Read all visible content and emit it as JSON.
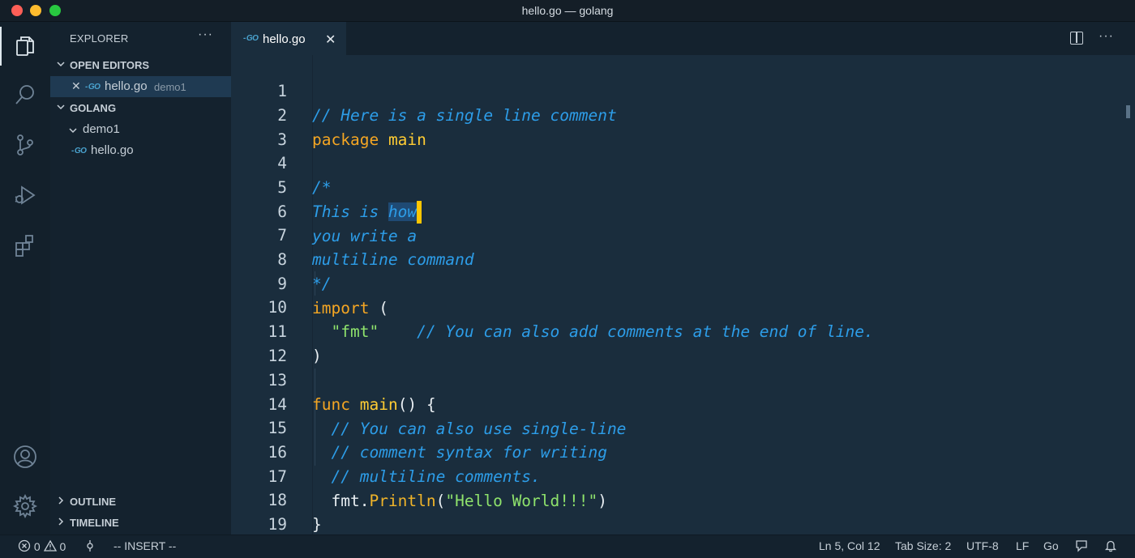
{
  "window": {
    "title": "hello.go — golang"
  },
  "sidebar": {
    "header": "EXPLORER",
    "more": "···",
    "open_editors": {
      "label": "OPEN EDITORS",
      "items": [
        {
          "close": "✕",
          "name": "hello.go",
          "folder": "demo1"
        }
      ]
    },
    "workspace": {
      "label": "GOLANG",
      "folder": "demo1",
      "file": "hello.go"
    },
    "outline": "OUTLINE",
    "timeline": "TIMELINE"
  },
  "editor": {
    "tab": {
      "name": "hello.go",
      "close": "✕",
      "icon": "GO"
    },
    "more": "···",
    "line_numbers": [
      "1",
      "2",
      "3",
      "4",
      "5",
      "6",
      "7",
      "8",
      "9",
      "10",
      "11",
      "12",
      "13",
      "14",
      "15",
      "16",
      "17",
      "18",
      "19"
    ],
    "code": {
      "l1": "// Here is a single line comment",
      "l2_kw": "package",
      "l2_name": "main",
      "l4": "/*",
      "l5_a": "This is ",
      "l5_sel": "how",
      "l6": "you write a",
      "l7": "multiline command",
      "l8": "*/",
      "l9_kw": "import",
      "l9_p": " (",
      "l10_str": "\"fmt\"",
      "l10_cm": "// You can also add comments at the end of line.",
      "l11": ")",
      "l13_kw": "func",
      "l13_fn": "main",
      "l13_rest": "() {",
      "l14": "// You can also use single-line",
      "l15": "// comment syntax for writing",
      "l16": "// multiline comments.",
      "l17_pkg": "fmt.",
      "l17_fn": "Println",
      "l17_open": "(",
      "l17_str": "\"Hello World!!!\"",
      "l17_close": ")",
      "l18": "}"
    }
  },
  "statusbar": {
    "errors": "0",
    "warnings": "0",
    "mode": "-- INSERT --",
    "position": "Ln 5, Col 12",
    "tab_size": "Tab Size: 2",
    "encoding": "UTF-8",
    "eol": "LF",
    "language": "Go"
  },
  "colors": {
    "comment": "#2d9de8",
    "keyword": "#f5a623",
    "string": "#8fe36c",
    "cursor": "#ffc600",
    "editor_bg": "#1a2d3d"
  }
}
